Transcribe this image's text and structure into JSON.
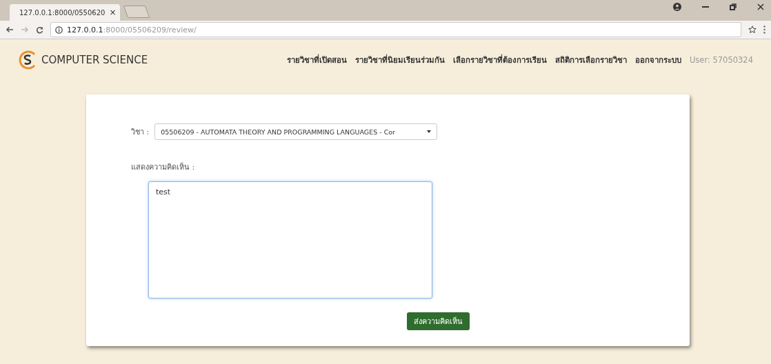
{
  "browser": {
    "tab": {
      "title": "127.0.0.1:8000/0550620",
      "close": "×"
    },
    "url_host": "127.0.0.1",
    "url_path": ":8000/05506209/review/"
  },
  "brand": {
    "name": "COMPUTER SCIENCE"
  },
  "nav": [
    {
      "label": "รายวิชาที่เปิดสอน",
      "kind": "link"
    },
    {
      "label": "รายวิชาที่นิยมเรียนร่วมกัน",
      "kind": "link"
    },
    {
      "label": "เลือกรายวิชาที่ต้องการเรียน",
      "kind": "link"
    },
    {
      "label": "สถิติการเลือกรายวิชา",
      "kind": "link"
    },
    {
      "label": "ออกจากระบบ",
      "kind": "link"
    },
    {
      "label": "User: 57050324",
      "kind": "user"
    }
  ],
  "form": {
    "subject_label": "วิชา :",
    "subject_value": "05506209 - AUTOMATA THEORY AND PROGRAMMING LANGUAGES - Cor",
    "comment_label": "แสดงความคิดเห็น :",
    "comment_value": "test",
    "submit": "ส่งความคิดเห็น"
  }
}
